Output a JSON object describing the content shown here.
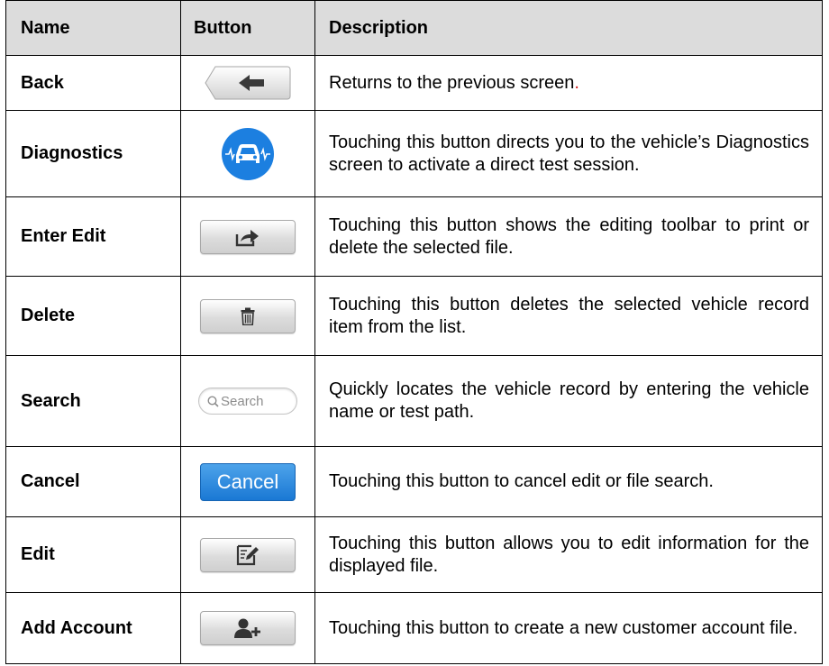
{
  "table": {
    "headers": {
      "name": "Name",
      "button": "Button",
      "description": "Description"
    },
    "rows": [
      {
        "name": "Back",
        "icon": "back-arrow-icon",
        "description": "Returns to the previous screen",
        "trailing": "."
      },
      {
        "name": "Diagnostics",
        "icon": "car-diagnostics-icon",
        "description": "Touching this button directs you to the vehicle’s Diagnostics screen to activate a direct test session."
      },
      {
        "name": "Enter Edit",
        "icon": "share-export-icon",
        "description": "Touching this button shows the editing toolbar to print or delete the selected file."
      },
      {
        "name": "Delete",
        "icon": "trash-icon",
        "description": "Touching this button deletes the selected vehicle record item from the list."
      },
      {
        "name": "Search",
        "icon": "search-field",
        "search_placeholder": "Search",
        "description": "Quickly locates the vehicle record by entering the vehicle name or test path."
      },
      {
        "name": "Cancel",
        "icon": "cancel-button",
        "button_label": "Cancel",
        "description": "Touching this button to cancel edit or file search."
      },
      {
        "name": "Edit",
        "icon": "edit-note-icon",
        "description": "Touching this button allows you to edit information for the displayed file."
      },
      {
        "name": "Add Account",
        "icon": "add-user-icon",
        "description": "Touching this button to create a new customer account file."
      }
    ]
  },
  "colors": {
    "header_bg": "#dcdcdc",
    "cancel_blue": "#1a78d4",
    "diagnostics_blue": "#1c7fe0",
    "period_red": "#d11f1f"
  }
}
